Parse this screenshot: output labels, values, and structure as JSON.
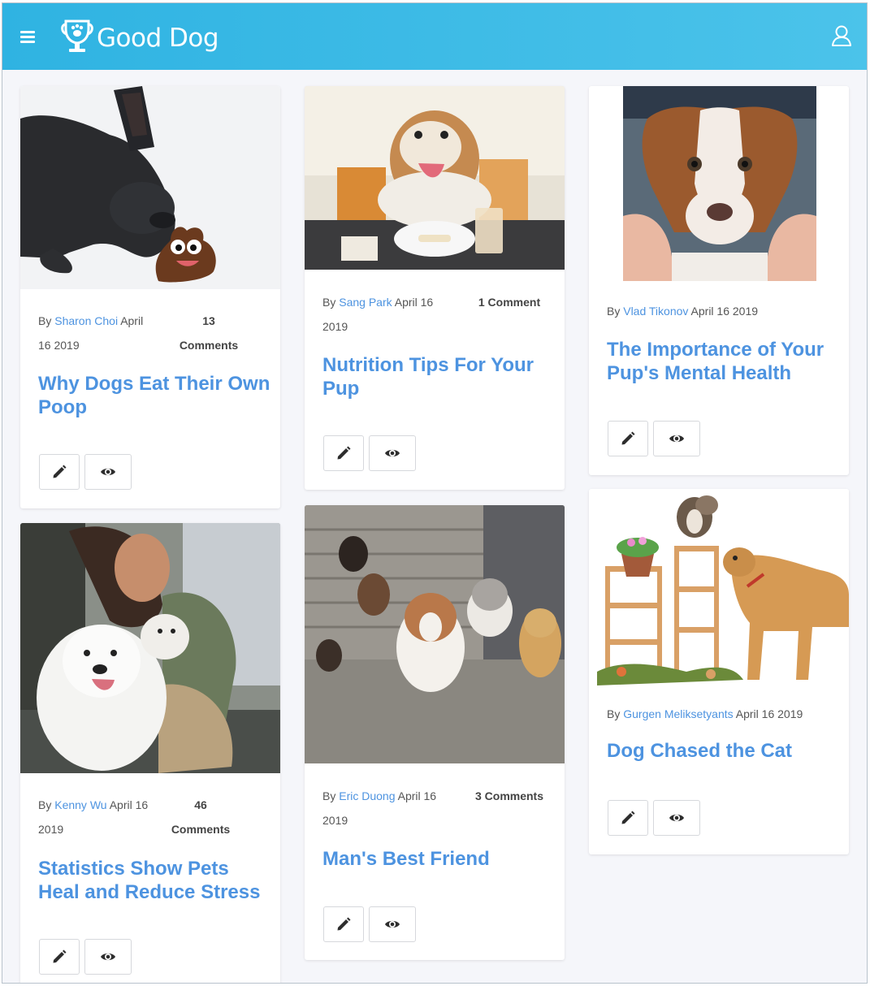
{
  "app": {
    "brand": "Good Dog"
  },
  "colors": {
    "header": "#36b8e6",
    "link": "#4d93e0",
    "background": "#f5f6fa"
  },
  "icons": {
    "menu": "hamburger-icon",
    "logo": "trophy-paw-icon",
    "user": "user-icon",
    "edit": "pencil-icon",
    "view": "eye-icon"
  },
  "posts": [
    {
      "by": "By",
      "author": "Sharon Choi",
      "date_a": "April",
      "date_b": "16 2019",
      "comments_a": "13",
      "comments_b": "Comments",
      "title": "Why Dogs Eat Their Own Poop"
    },
    {
      "by": "By",
      "author": "Sang Park",
      "date_a": "April 16",
      "date_b": "2019",
      "comments_a": "1 Comment",
      "title": "Nutrition Tips For Your Pup"
    },
    {
      "by": "By",
      "author": "Vlad Tikonov",
      "date_a": "April 16 2019",
      "title": "The Importance of Your Pup's Mental Health"
    },
    {
      "by": "By",
      "author": "Kenny Wu",
      "date_a": "April 16",
      "date_b": "2019",
      "comments_a": "46",
      "comments_b": "Comments",
      "title": "Statistics Show Pets Heal and Reduce Stress"
    },
    {
      "by": "By",
      "author": "Eric Duong",
      "date_a": "April 16",
      "date_b": "2019",
      "comments_a": "3 Comments",
      "title": "Man's Best Friend"
    },
    {
      "by": "By",
      "author": "Gurgen Meliksetyants",
      "date_a": "April 16 2019",
      "title": "Dog Chased the Cat"
    }
  ]
}
